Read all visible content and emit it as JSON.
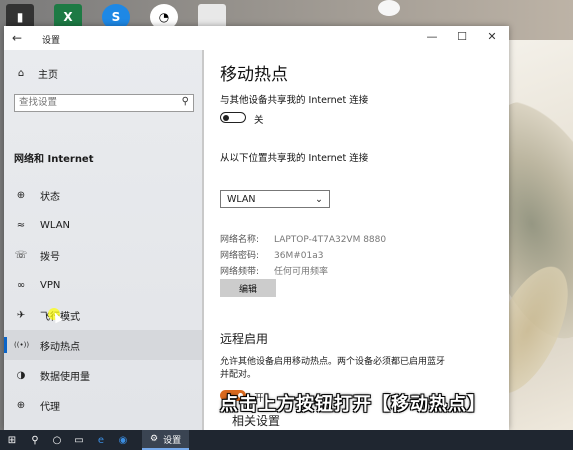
{
  "window": {
    "title": "设置",
    "back_glyph": "←",
    "minimize": "—",
    "maximize": "☐",
    "close": "✕"
  },
  "sidebar": {
    "home": "主页",
    "search_placeholder": "查找设置",
    "section_title": "网络和 Internet",
    "items": [
      {
        "label": "状态",
        "icon": "globe-status-icon",
        "glyph": "⊕"
      },
      {
        "label": "WLAN",
        "icon": "wifi-icon",
        "glyph": "≈"
      },
      {
        "label": "拨号",
        "icon": "dialup-icon",
        "glyph": "☏"
      },
      {
        "label": "VPN",
        "icon": "vpn-icon",
        "glyph": "∞"
      },
      {
        "label": "飞行模式",
        "icon": "airplane-icon",
        "glyph": "✈"
      },
      {
        "label": "移动热点",
        "icon": "hotspot-icon",
        "glyph": "((•))",
        "active": true
      },
      {
        "label": "数据使用量",
        "icon": "data-usage-icon",
        "glyph": "◑"
      },
      {
        "label": "代理",
        "icon": "proxy-icon",
        "glyph": "⊕"
      }
    ]
  },
  "content": {
    "title": "移动热点",
    "share_label": "与其他设备共享我的 Internet 连接",
    "share_state": "关",
    "from_label": "从以下位置共享我的 Internet 连接",
    "from_value": "WLAN",
    "network_name_key": "网络名称:",
    "network_name_value": "LAPTOP-4T7A32VM 8880",
    "network_password_key": "网络密码:",
    "network_password_value": "36M#01a3",
    "network_band_key": "网络频带:",
    "network_band_value": "任何可用频率",
    "edit_button": "编辑",
    "remote_title": "远程启用",
    "remote_desc": "允许其他设备启用移动热点。两个设备必须都已启用蓝牙并配对。",
    "remote_state": "开",
    "cutoff_text": "相关设置"
  },
  "caption": "点击上方按钮打开【移动热点】",
  "taskbar": {
    "settings_label": "设置"
  },
  "colors": {
    "accent": "#0a64c8",
    "toggle_on": "#d9691e",
    "taskbar": "#1f2630"
  }
}
